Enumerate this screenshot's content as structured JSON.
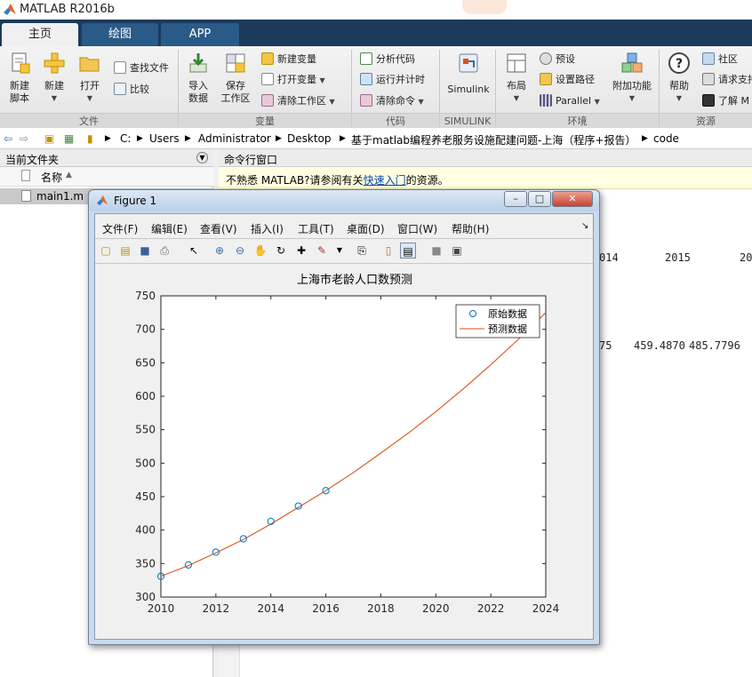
{
  "app": {
    "title": "MATLAB R2016b"
  },
  "tabs": [
    {
      "label": "主页"
    },
    {
      "label": "绘图"
    },
    {
      "label": "APP"
    }
  ],
  "ribbon": {
    "file": {
      "new_script_l1": "新建",
      "new_script_l2": "脚本",
      "new": "新建",
      "open": "打开",
      "find_files": "查找文件",
      "compare": "比较",
      "group": "文件"
    },
    "variable": {
      "import_l1": "导入",
      "import_l2": "数据",
      "save_ws_l1": "保存",
      "save_ws_l2": "工作区",
      "new_var": "新建变量",
      "open_var": "打开变量",
      "clear_ws": "清除工作区",
      "group": "变量"
    },
    "code": {
      "analyze": "分析代码",
      "run_time": "运行并计时",
      "clear_cmd": "清除命令",
      "group": "代码"
    },
    "simulink": {
      "label": "Simulink",
      "group": "SIMULINK"
    },
    "environment": {
      "layout": "布局",
      "prefs": "预设",
      "set_path": "设置路径",
      "parallel": "Parallel",
      "addons": "附加功能",
      "group": "环境"
    },
    "resources": {
      "help": "帮助",
      "community": "社区",
      "request_support": "请求支持",
      "learn": "了解 M",
      "group": "资源"
    }
  },
  "address": {
    "segments": [
      "C:",
      "Users",
      "Administrator",
      "Desktop",
      "基于matlab编程养老服务设施配建问题-上海（程序+报告）",
      "code"
    ]
  },
  "current_folder": {
    "title": "当前文件夹",
    "column_name": "名称",
    "files": [
      "main1.m"
    ]
  },
  "command_window": {
    "title": "命令行窗口",
    "notice_prefix": "不熟悉 MATLAB?请参阅有关",
    "notice_link": "快速入门",
    "notice_suffix": "的资源。",
    "years_fragment": [
      "014",
      "2015",
      "20"
    ],
    "values_fragment": [
      "75",
      "459.4870",
      "485.7796"
    ]
  },
  "figure": {
    "title": "Figure 1",
    "menus": [
      "文件(F)",
      "编辑(E)",
      "查看(V)",
      "插入(I)",
      "工具(T)",
      "桌面(D)",
      "窗口(W)",
      "帮助(H)"
    ]
  },
  "colors": {
    "data_markers": "#0072bd",
    "fit_line": "#d95319",
    "ribbon_tabs": "#1b3a5c"
  },
  "chart_data": {
    "type": "line",
    "title": "上海市老龄人口数预测",
    "xlabel": "",
    "ylabel": "",
    "xlim": [
      2010,
      2024
    ],
    "ylim": [
      300,
      750
    ],
    "xticks": [
      2010,
      2012,
      2014,
      2016,
      2018,
      2020,
      2022,
      2024
    ],
    "yticks": [
      300,
      350,
      400,
      450,
      500,
      550,
      600,
      650,
      700,
      750
    ],
    "legend_position": "top-right",
    "grid": false,
    "series": [
      {
        "name": "原始数据",
        "style": "markers",
        "x": [
          2010,
          2011,
          2012,
          2013,
          2014,
          2015,
          2016
        ],
        "y": [
          331,
          348,
          367,
          387,
          413,
          436,
          459
        ]
      },
      {
        "name": "预测数据",
        "style": "line",
        "x": [
          2010,
          2011,
          2012,
          2013,
          2014,
          2015,
          2016,
          2017,
          2018,
          2019,
          2020,
          2021,
          2022,
          2023,
          2024
        ],
        "y": [
          331,
          347,
          366,
          386,
          409,
          434,
          459,
          486,
          515,
          545,
          577,
          611,
          647,
          685,
          725
        ]
      }
    ]
  }
}
